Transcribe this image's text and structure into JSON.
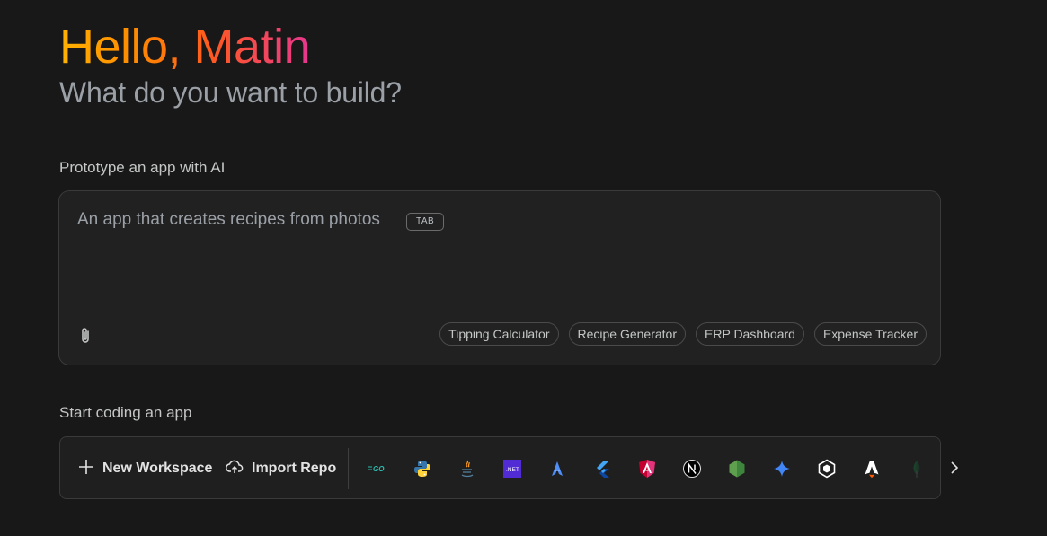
{
  "greeting": "Hello, Matin",
  "subtitle": "What do you want to build?",
  "prototype": {
    "label": "Prototype an app with AI",
    "placeholder": "An app that creates recipes from photos",
    "tab_hint": "TAB",
    "suggestions": [
      "Tipping Calculator",
      "Recipe Generator",
      "ERP Dashboard",
      "Expense Tracker"
    ]
  },
  "coding": {
    "label": "Start coding an app",
    "new_workspace": "New Workspace",
    "import_repo": "Import Repo",
    "templates": [
      {
        "name": "go-icon",
        "text": "GO",
        "color": "#29beb0"
      },
      {
        "name": "python-icon",
        "color": "#3776ab"
      },
      {
        "name": "java-icon",
        "color": "#f89820"
      },
      {
        "name": "dotnet-icon",
        "text": ".NET",
        "color": "#512bd4"
      },
      {
        "name": "astro-blue-icon",
        "color": "#4f8ff7"
      },
      {
        "name": "flutter-icon",
        "color": "#42a5f5"
      },
      {
        "name": "angular-icon",
        "color": "#e2337b"
      },
      {
        "name": "nextjs-icon",
        "text": "N",
        "color": "#ffffff"
      },
      {
        "name": "nodejs-icon",
        "color": "#5fa04e"
      },
      {
        "name": "gemini-icon",
        "color": "#4285f4"
      },
      {
        "name": "hexagon-icon",
        "color": "#ffffff"
      },
      {
        "name": "astro-icon",
        "color": "#ffffff"
      },
      {
        "name": "mongodb-icon",
        "color": "#13aa52"
      }
    ]
  },
  "colors": {
    "background": "#181818",
    "greeting_gradient": [
      "#ffb300",
      "#ff8a00",
      "#ff5a1f",
      "#e8368f"
    ]
  }
}
